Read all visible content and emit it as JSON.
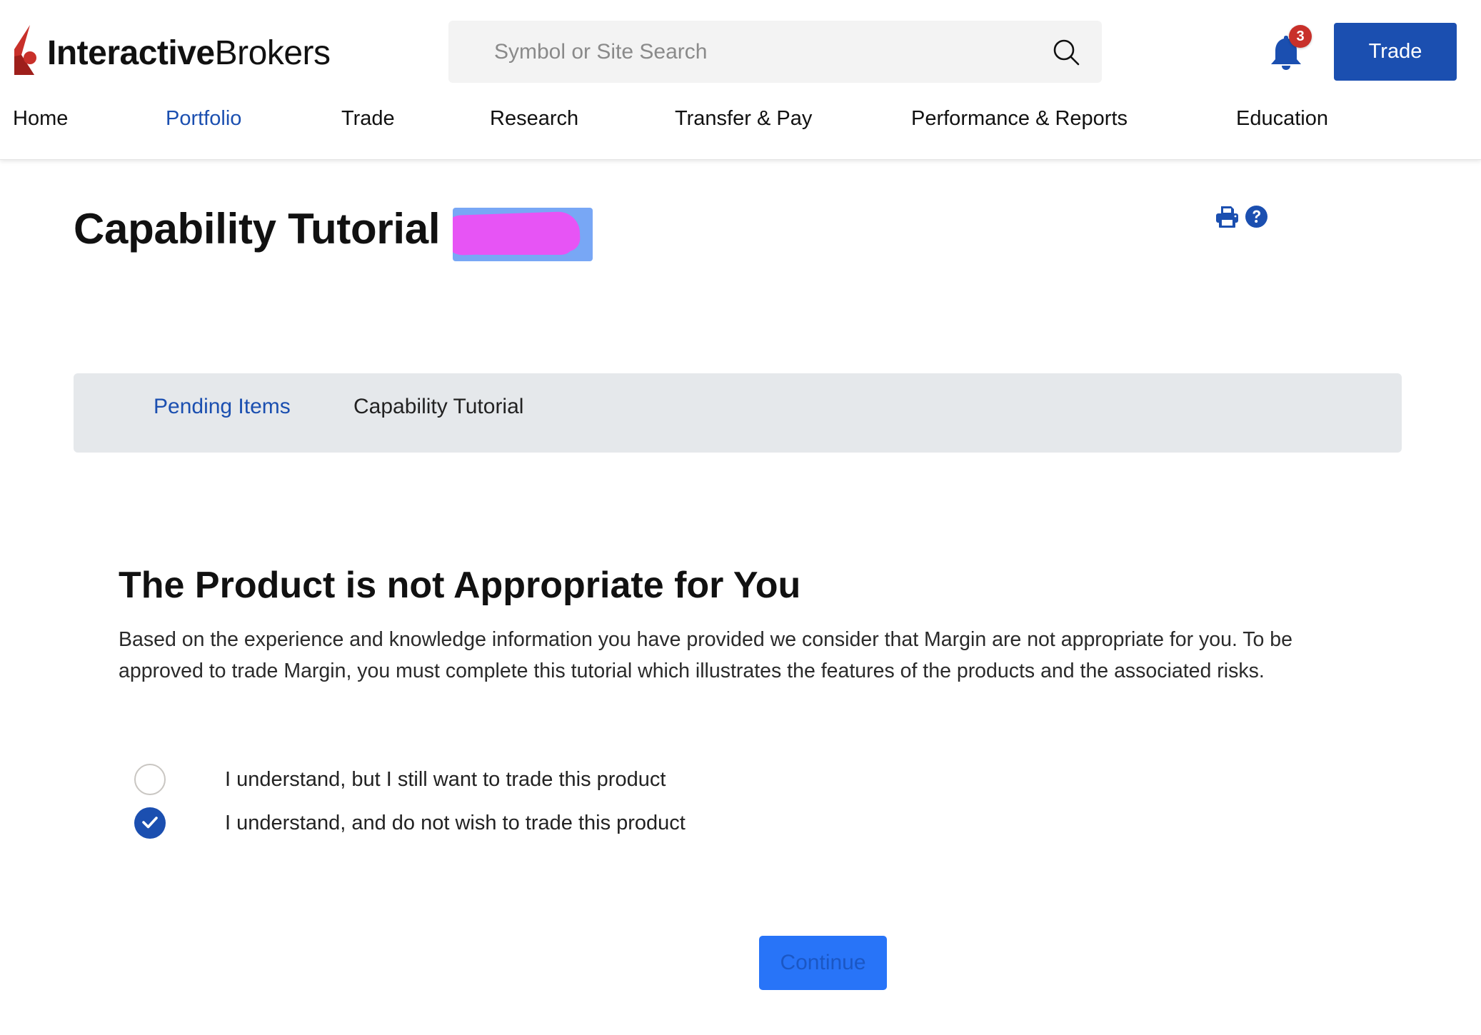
{
  "brand": {
    "name_bold": "Interactive",
    "name_light": "Brokers",
    "logo_icon": "ib-logo-icon",
    "logo_color": "#c8302a"
  },
  "header": {
    "search": {
      "placeholder": "Symbol or Site Search",
      "value": "",
      "icon": "search-icon"
    },
    "notifications": {
      "icon": "bell-icon",
      "count": "3"
    },
    "trade_button_label": "Trade"
  },
  "nav": {
    "items": [
      {
        "label": "Home",
        "active": false
      },
      {
        "label": "Portfolio",
        "active": true
      },
      {
        "label": "Trade",
        "active": false
      },
      {
        "label": "Research",
        "active": false
      },
      {
        "label": "Transfer & Pay",
        "active": false
      },
      {
        "label": "Performance & Reports",
        "active": false
      },
      {
        "label": "Education",
        "active": false
      }
    ]
  },
  "page": {
    "title": "Capability Tutorial",
    "icons": [
      "print-icon",
      "help-icon"
    ]
  },
  "breadcrumb": {
    "items": [
      {
        "label": "Pending Items",
        "link": true
      },
      {
        "label": "Capability Tutorial",
        "link": false
      }
    ]
  },
  "content": {
    "heading": "The Product is not Appropriate for You",
    "paragraph": "Based on the experience and knowledge information you have provided we consider that Margin are not appropriate for you. To be approved to trade Margin, you must complete this tutorial which illustrates the features of the products and the associated risks.",
    "options": [
      {
        "label": "I understand, but I still want to trade this product",
        "checked": false
      },
      {
        "label": "I understand, and do not wish to trade this product",
        "checked": true
      }
    ],
    "continue_label": "Continue"
  },
  "colors": {
    "primary": "#1b4fb0",
    "continue_bg": "#2874f8",
    "badge": "#c8302a",
    "breadcrumb_bg": "#e5e8eb",
    "search_bg": "#f3f3f3"
  }
}
